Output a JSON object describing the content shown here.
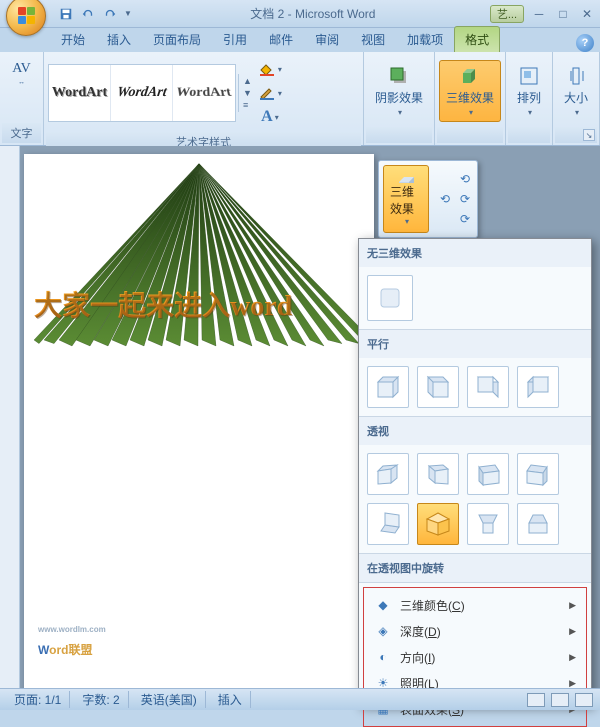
{
  "app": {
    "title": "文档 2 - Microsoft Word",
    "contextual_label": "艺..."
  },
  "qat": {
    "save": "保存",
    "undo": "撤销",
    "redo": "重做"
  },
  "tabs": {
    "items": [
      {
        "label": "开始"
      },
      {
        "label": "插入"
      },
      {
        "label": "页面布局"
      },
      {
        "label": "引用"
      },
      {
        "label": "邮件"
      },
      {
        "label": "审阅"
      },
      {
        "label": "视图"
      },
      {
        "label": "加载项"
      },
      {
        "label": "格式"
      }
    ],
    "active": "格式"
  },
  "ribbon": {
    "text_group": {
      "label": "文字",
      "spacing": "AV"
    },
    "styles_group": {
      "label": "艺术字样式"
    },
    "shadow_group": {
      "label": "阴影效果"
    },
    "threeD_group": {
      "label": "三维效果"
    },
    "arrange_group": {
      "label": "排列"
    },
    "size_group": {
      "label": "大小"
    }
  },
  "wordart_gallery": [
    "WordArt",
    "WordArt",
    "WordArt"
  ],
  "popup": {
    "threeD_label": "三维效果"
  },
  "dropdown": {
    "no3d_label": "无三维效果",
    "parallel_label": "平行",
    "perspective_label": "透视",
    "rotate_label": "在透视图中旋转",
    "menu": [
      {
        "label": "三维颜色",
        "key": "C",
        "icon": "palette"
      },
      {
        "label": "深度",
        "key": "D",
        "icon": "depth"
      },
      {
        "label": "方向",
        "key": "I",
        "icon": "direction"
      },
      {
        "label": "照明",
        "key": "L",
        "icon": "lighting"
      },
      {
        "label": "表面效果",
        "key": "S",
        "icon": "surface"
      }
    ]
  },
  "document": {
    "art_text": "大家一起来进入word"
  },
  "statusbar": {
    "page": "页面: 1/1",
    "words": "字数: 2",
    "lang": "英语(美国)",
    "mode": "插入"
  },
  "watermark": {
    "url": "www.wordlm.com",
    "brand_w": "W",
    "brand_ord": "ord",
    "brand_lm": "联盟"
  }
}
